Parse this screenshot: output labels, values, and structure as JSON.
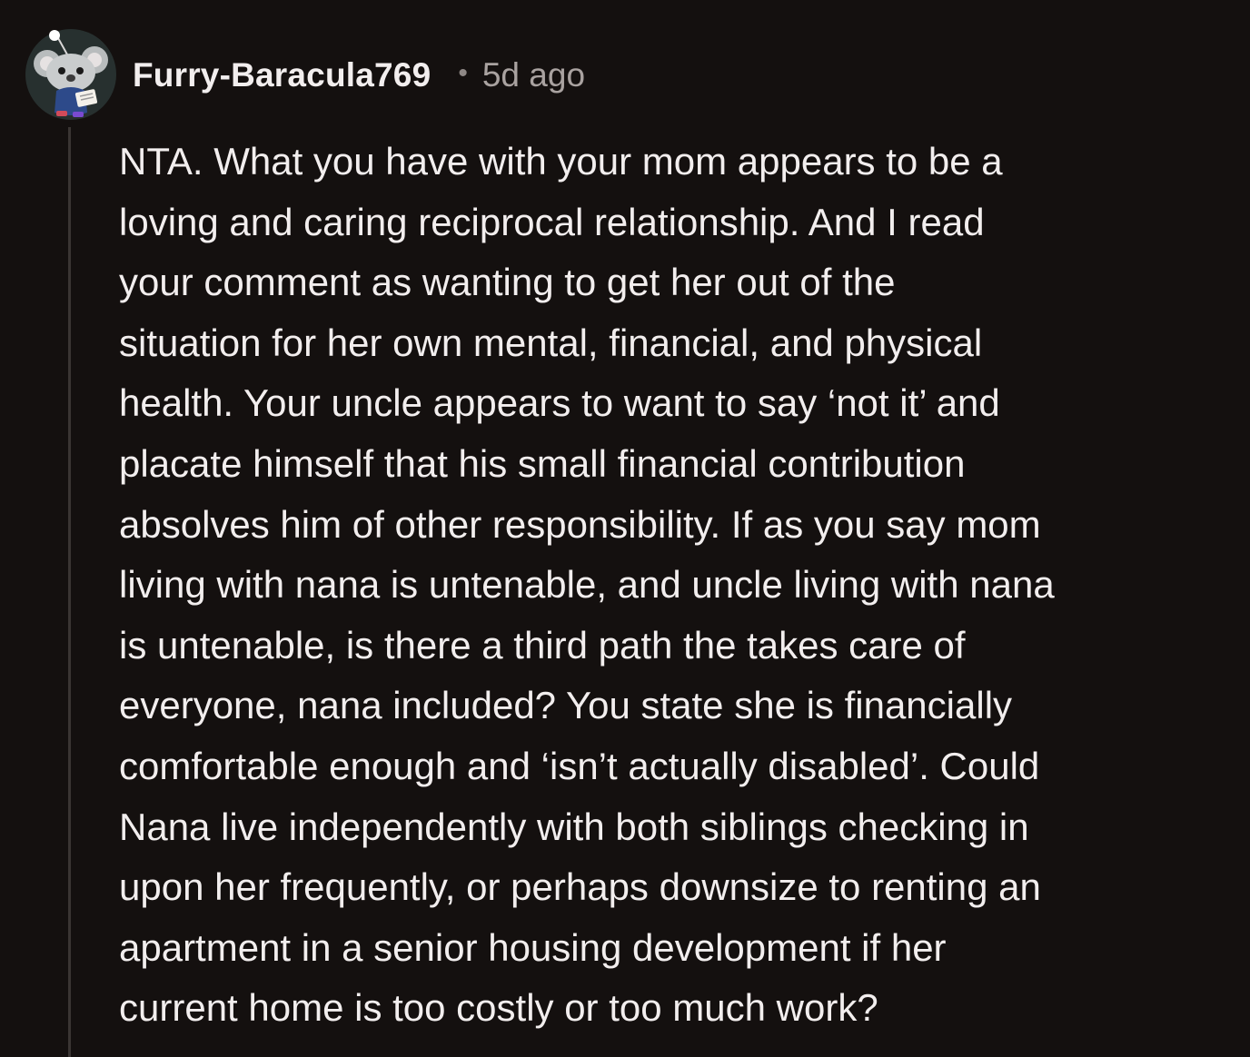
{
  "comment": {
    "avatar_icon": "snoo-avatar-icon",
    "username": "Furry-Baracula769",
    "separator": "•",
    "timestamp": "5d ago",
    "body": "NTA. What you have with your mom appears to be a\nloving and caring reciprocal relationship. And I read\nyour comment as wanting to get her out of the\nsituation for her own mental, financial, and physical\nhealth. Your uncle appears to want to say ‘not it’ and\nplacate himself that his small financial contribution\nabsolves him of other responsibility. If as you say mom\nliving with nana is untenable, and uncle living with nana\nis untenable, is there a third path the takes care of\neveryone, nana included? You state she is financially\ncomfortable enough and ‘isn’t actually disabled’. Could\nNana live independently with both siblings checking in\nupon her frequently, or perhaps downsize to renting an\napartment in a senior housing development if her\ncurrent home is too costly or too much work?"
  },
  "colors": {
    "background": "#14100f",
    "text": "#f2eeee",
    "muted": "#a9a2a0",
    "thread_line": "#3a3533"
  }
}
